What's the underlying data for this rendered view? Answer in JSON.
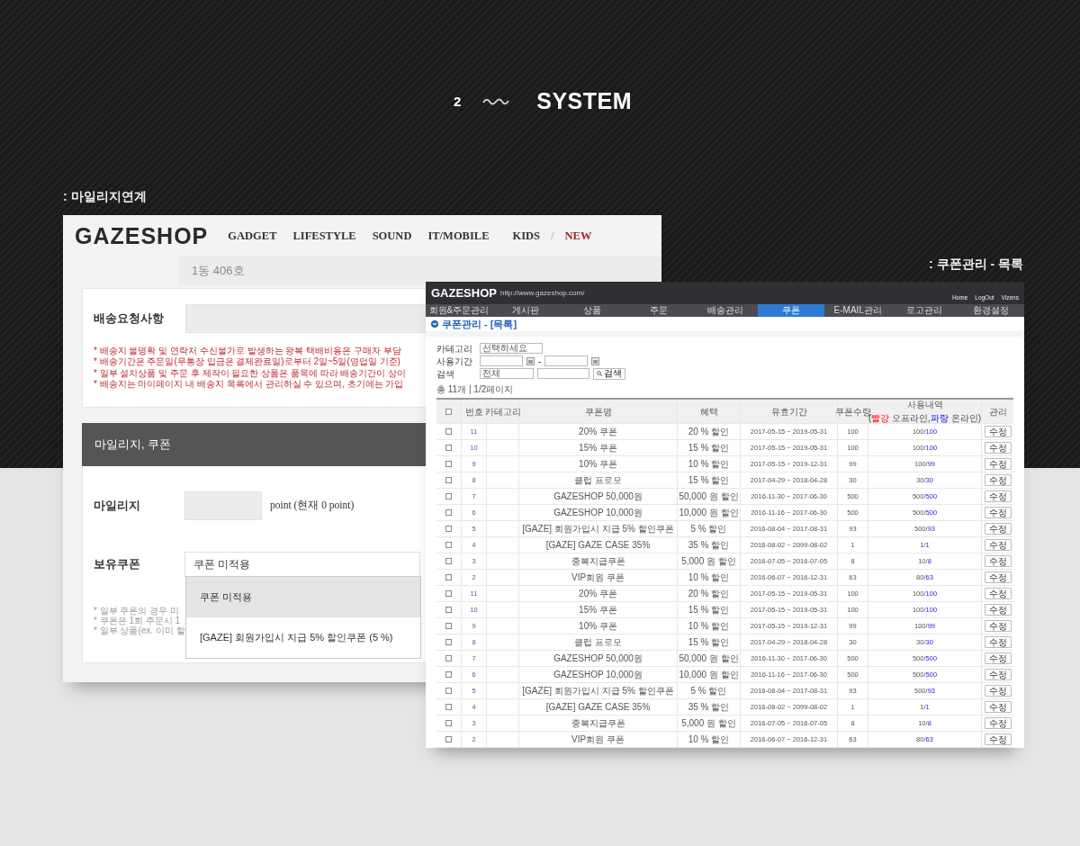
{
  "header": {
    "number": "2",
    "title": "SYSTEM"
  },
  "mileage_screen": {
    "label": ": 마일리지연계",
    "logo": "GAZESHOP",
    "nav": [
      {
        "label": "GADGET",
        "kind": "link"
      },
      {
        "label": "LIFESTYLE",
        "kind": "link"
      },
      {
        "label": "SOUND",
        "kind": "link"
      },
      {
        "label": "IT/MOBILE",
        "kind": "link"
      },
      {
        "label": "KIDS",
        "kind": "link"
      },
      {
        "label": "/",
        "kind": "divider"
      },
      {
        "label": "NEW",
        "kind": "highlight"
      }
    ],
    "address_detail": "1동 406호",
    "request_label": "배송요청사항",
    "notices": [
      "* 배송지 불명확 및 연락처 수신불가로 발생하는 왕복 택배비용은 구매자 부담",
      "* 배송기간은 주문일(무통장 입금은 결제완료일)로부터 2일~5일(영업일 기준)",
      "* 일부 설치상품 및 주문 후 제작이 필요한 상품은 품목에 따라 배송기간이 상이",
      "* 배송지는 마이페이지 내 배송지 목록에서 관리하실 수 있으며, 초기에는 가입"
    ],
    "panel_title": "마일리지, 쿠폰",
    "mileage_label": "마일리지",
    "mileage_unit": "point (현재 0 point)",
    "coupon_label": "보유쿠폰",
    "coupon_value": "쿠폰 미적용",
    "coupon_options": [
      {
        "label": "쿠폰 미적용",
        "selected": true
      },
      {
        "label": "[GAZE] 회원가입시 지급 5% 할인쿠폰 (5 %)",
        "selected": false
      }
    ],
    "coupon_notes": [
      "* 일부 쿠폰의 경우 미",
      "* 쿠폰은 1회 주문시 1",
      "* 일부 상품(ex. 이미 할"
    ]
  },
  "coupon_screen": {
    "label": ": 쿠폰관리 - 목록",
    "logo": "GAZESHOP",
    "url": "http://www.gazeshop.com/",
    "top_links": [
      "Home",
      "LogOut",
      "Vizens"
    ],
    "tabs": [
      {
        "label": "회원&주문관리",
        "selected": false
      },
      {
        "label": "게시판",
        "selected": false
      },
      {
        "label": "상품",
        "selected": false
      },
      {
        "label": "주문",
        "selected": false
      },
      {
        "label": "배송관리",
        "selected": false
      },
      {
        "label": "쿠폰",
        "selected": true
      },
      {
        "label": "E-MAIL관리",
        "selected": false
      },
      {
        "label": "로고관리",
        "selected": false
      },
      {
        "label": "환경설정",
        "selected": false
      }
    ],
    "page_title": "쿠폰관리 - [목록]",
    "filters": {
      "category_label": "카테고리",
      "category_value": "선택하세요",
      "period_label": "사용기간",
      "period_separator": "-",
      "search_label": "검색",
      "search_scope": "전체",
      "search_button": "검색"
    },
    "summary": "총 11개 | 1/2페이지",
    "columns": [
      {
        "kind": "checkbox",
        "checked": false
      },
      {
        "kind": "text",
        "label": "번호"
      },
      {
        "kind": "text",
        "label": "카테고리"
      },
      {
        "kind": "text",
        "label": "쿠폰명"
      },
      {
        "kind": "text",
        "label": "혜택"
      },
      {
        "kind": "text",
        "label": "유효기간"
      },
      {
        "kind": "text",
        "label": "쿠폰수량"
      },
      {
        "kind": "usage",
        "label": "사용내역",
        "legend": [
          {
            "text": "(",
            "kind": "plain"
          },
          {
            "text": "빨강",
            "kind": "offline"
          },
          {
            "text": " 오프라인,",
            "kind": "plain"
          },
          {
            "text": "파랑",
            "kind": "online"
          },
          {
            "text": " 온라인)",
            "kind": "plain"
          }
        ]
      },
      {
        "kind": "text",
        "label": "관리"
      }
    ],
    "rows": [
      {
        "checked": false,
        "number": "11",
        "name": "20% 쿠폰",
        "benefit": "20 % 할인",
        "period": "2017-05-15 ~ 2019-05-31",
        "quantity": "100",
        "usage_offline": "100/",
        "usage_online": "100",
        "action": "수정"
      },
      {
        "checked": false,
        "number": "10",
        "name": "15% 쿠폰",
        "benefit": "15 % 할인",
        "period": "2017-05-15 ~ 2019-05-31",
        "quantity": "100",
        "usage_offline": "100/",
        "usage_online": "100",
        "action": "수정"
      },
      {
        "checked": false,
        "number": "9",
        "name": "10% 쿠폰",
        "benefit": "10 % 할인",
        "period": "2017-05-15 ~ 2019-12-31",
        "quantity": "99",
        "usage_offline": "100/",
        "usage_online": "99",
        "action": "수정"
      },
      {
        "checked": false,
        "number": "8",
        "name": "클럽 프로모",
        "benefit": "15 % 할인",
        "period": "2017-04-29 ~ 2018-04-28",
        "quantity": "30",
        "usage_offline": "30/",
        "usage_online": "30",
        "action": "수정"
      },
      {
        "checked": false,
        "number": "7",
        "name": "GAZESHOP 50,000원",
        "benefit": "50,000 원 할인",
        "period": "2016-11-30 ~ 2017-06-30",
        "quantity": "500",
        "usage_offline": "500/",
        "usage_online": "500",
        "action": "수정"
      },
      {
        "checked": false,
        "number": "6",
        "name": "GAZESHOP 10,000원",
        "benefit": "10,000 원 할인",
        "period": "2016-11-16 ~ 2017-06-30",
        "quantity": "500",
        "usage_offline": "500/",
        "usage_online": "500",
        "action": "수정"
      },
      {
        "checked": false,
        "number": "5",
        "name": "[GAZE] 회원가입시 지급 5% 할인쿠폰",
        "benefit": "5 % 할인",
        "period": "2016-08-04 ~ 2017-08-31",
        "quantity": "93",
        "usage_offline": "500/",
        "usage_online": "93",
        "action": "수정"
      },
      {
        "checked": false,
        "number": "4",
        "name": "[GAZE] GAZE CASE 35%",
        "benefit": "35 % 할인",
        "period": "2016-08-02 ~ 2099-08-02",
        "quantity": "1",
        "usage_offline": "1/",
        "usage_online": "1",
        "action": "수정"
      },
      {
        "checked": false,
        "number": "3",
        "name": "중복지급쿠폰",
        "benefit": "5,000 원 할인",
        "period": "2016-07-05 ~ 2016-07-05",
        "quantity": "8",
        "usage_offline": "10/",
        "usage_online": "8",
        "action": "수정"
      },
      {
        "checked": false,
        "number": "2",
        "name": "VIP회원 쿠폰",
        "benefit": "10 % 할인",
        "period": "2016-06-07 ~ 2016-12-31",
        "quantity": "63",
        "usage_offline": "80/",
        "usage_online": "63",
        "action": "수정"
      },
      {
        "checked": false,
        "number": "11",
        "name": "20% 쿠폰",
        "benefit": "20 % 할인",
        "period": "2017-05-15 ~ 2019-05-31",
        "quantity": "100",
        "usage_offline": "100/",
        "usage_online": "100",
        "action": "수정"
      },
      {
        "checked": false,
        "number": "10",
        "name": "15% 쿠폰",
        "benefit": "15 % 할인",
        "period": "2017-05-15 ~ 2019-05-31",
        "quantity": "100",
        "usage_offline": "100/",
        "usage_online": "100",
        "action": "수정"
      },
      {
        "checked": false,
        "number": "9",
        "name": "10% 쿠폰",
        "benefit": "10 % 할인",
        "period": "2017-05-15 ~ 2019-12-31",
        "quantity": "99",
        "usage_offline": "100/",
        "usage_online": "99",
        "action": "수정"
      },
      {
        "checked": false,
        "number": "8",
        "name": "클럽 프로모",
        "benefit": "15 % 할인",
        "period": "2017-04-29 ~ 2018-04-28",
        "quantity": "30",
        "usage_offline": "30/",
        "usage_online": "30",
        "action": "수정"
      },
      {
        "checked": false,
        "number": "7",
        "name": "GAZESHOP 50,000원",
        "benefit": "50,000 원 할인",
        "period": "2016-11-30 ~ 2017-06-30",
        "quantity": "500",
        "usage_offline": "500/",
        "usage_online": "500",
        "action": "수정"
      },
      {
        "checked": false,
        "number": "6",
        "name": "GAZESHOP 10,000원",
        "benefit": "10,000 원 할인",
        "period": "2016-11-16 ~ 2017-06-30",
        "quantity": "500",
        "usage_offline": "500/",
        "usage_online": "500",
        "action": "수정"
      },
      {
        "checked": false,
        "number": "5",
        "name": "[GAZE] 회원가입시 지급 5% 할인쿠폰",
        "benefit": "5 % 할인",
        "period": "2016-08-04 ~ 2017-08-31",
        "quantity": "93",
        "usage_offline": "500/",
        "usage_online": "93",
        "action": "수정"
      },
      {
        "checked": false,
        "number": "4",
        "name": "[GAZE] GAZE CASE 35%",
        "benefit": "35 % 할인",
        "period": "2016-08-02 ~ 2099-08-02",
        "quantity": "1",
        "usage_offline": "1/",
        "usage_online": "1",
        "action": "수정"
      },
      {
        "checked": false,
        "number": "3",
        "name": "중복지급쿠폰",
        "benefit": "5,000 원 할인",
        "period": "2016-07-05 ~ 2016-07-05",
        "quantity": "8",
        "usage_offline": "10/",
        "usage_online": "8",
        "action": "수정"
      },
      {
        "checked": false,
        "number": "2",
        "name": "VIP회원 쿠폰",
        "benefit": "10 % 할인",
        "period": "2016-06-07 ~ 2016-12-31",
        "quantity": "63",
        "usage_offline": "80/",
        "usage_online": "63",
        "action": "수정"
      }
    ]
  }
}
